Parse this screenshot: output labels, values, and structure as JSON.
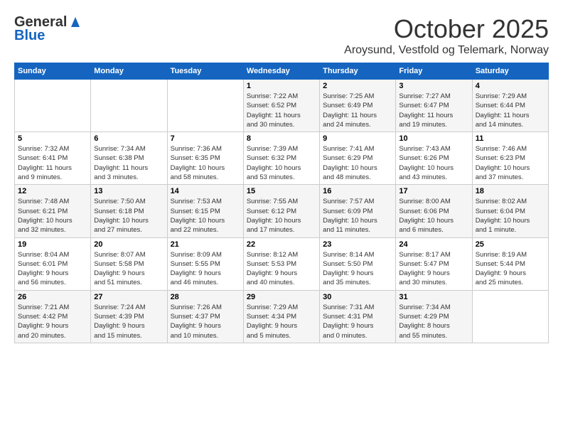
{
  "logo": {
    "general": "General",
    "blue": "Blue"
  },
  "title": {
    "month": "October 2025",
    "location": "Aroysund, Vestfold og Telemark, Norway"
  },
  "headers": [
    "Sunday",
    "Monday",
    "Tuesday",
    "Wednesday",
    "Thursday",
    "Friday",
    "Saturday"
  ],
  "weeks": [
    [
      {
        "day": "",
        "info": ""
      },
      {
        "day": "",
        "info": ""
      },
      {
        "day": "",
        "info": ""
      },
      {
        "day": "1",
        "info": "Sunrise: 7:22 AM\nSunset: 6:52 PM\nDaylight: 11 hours\nand 30 minutes."
      },
      {
        "day": "2",
        "info": "Sunrise: 7:25 AM\nSunset: 6:49 PM\nDaylight: 11 hours\nand 24 minutes."
      },
      {
        "day": "3",
        "info": "Sunrise: 7:27 AM\nSunset: 6:47 PM\nDaylight: 11 hours\nand 19 minutes."
      },
      {
        "day": "4",
        "info": "Sunrise: 7:29 AM\nSunset: 6:44 PM\nDaylight: 11 hours\nand 14 minutes."
      }
    ],
    [
      {
        "day": "5",
        "info": "Sunrise: 7:32 AM\nSunset: 6:41 PM\nDaylight: 11 hours\nand 9 minutes."
      },
      {
        "day": "6",
        "info": "Sunrise: 7:34 AM\nSunset: 6:38 PM\nDaylight: 11 hours\nand 3 minutes."
      },
      {
        "day": "7",
        "info": "Sunrise: 7:36 AM\nSunset: 6:35 PM\nDaylight: 10 hours\nand 58 minutes."
      },
      {
        "day": "8",
        "info": "Sunrise: 7:39 AM\nSunset: 6:32 PM\nDaylight: 10 hours\nand 53 minutes."
      },
      {
        "day": "9",
        "info": "Sunrise: 7:41 AM\nSunset: 6:29 PM\nDaylight: 10 hours\nand 48 minutes."
      },
      {
        "day": "10",
        "info": "Sunrise: 7:43 AM\nSunset: 6:26 PM\nDaylight: 10 hours\nand 43 minutes."
      },
      {
        "day": "11",
        "info": "Sunrise: 7:46 AM\nSunset: 6:23 PM\nDaylight: 10 hours\nand 37 minutes."
      }
    ],
    [
      {
        "day": "12",
        "info": "Sunrise: 7:48 AM\nSunset: 6:21 PM\nDaylight: 10 hours\nand 32 minutes."
      },
      {
        "day": "13",
        "info": "Sunrise: 7:50 AM\nSunset: 6:18 PM\nDaylight: 10 hours\nand 27 minutes."
      },
      {
        "day": "14",
        "info": "Sunrise: 7:53 AM\nSunset: 6:15 PM\nDaylight: 10 hours\nand 22 minutes."
      },
      {
        "day": "15",
        "info": "Sunrise: 7:55 AM\nSunset: 6:12 PM\nDaylight: 10 hours\nand 17 minutes."
      },
      {
        "day": "16",
        "info": "Sunrise: 7:57 AM\nSunset: 6:09 PM\nDaylight: 10 hours\nand 11 minutes."
      },
      {
        "day": "17",
        "info": "Sunrise: 8:00 AM\nSunset: 6:06 PM\nDaylight: 10 hours\nand 6 minutes."
      },
      {
        "day": "18",
        "info": "Sunrise: 8:02 AM\nSunset: 6:04 PM\nDaylight: 10 hours\nand 1 minute."
      }
    ],
    [
      {
        "day": "19",
        "info": "Sunrise: 8:04 AM\nSunset: 6:01 PM\nDaylight: 9 hours\nand 56 minutes."
      },
      {
        "day": "20",
        "info": "Sunrise: 8:07 AM\nSunset: 5:58 PM\nDaylight: 9 hours\nand 51 minutes."
      },
      {
        "day": "21",
        "info": "Sunrise: 8:09 AM\nSunset: 5:55 PM\nDaylight: 9 hours\nand 46 minutes."
      },
      {
        "day": "22",
        "info": "Sunrise: 8:12 AM\nSunset: 5:53 PM\nDaylight: 9 hours\nand 40 minutes."
      },
      {
        "day": "23",
        "info": "Sunrise: 8:14 AM\nSunset: 5:50 PM\nDaylight: 9 hours\nand 35 minutes."
      },
      {
        "day": "24",
        "info": "Sunrise: 8:17 AM\nSunset: 5:47 PM\nDaylight: 9 hours\nand 30 minutes."
      },
      {
        "day": "25",
        "info": "Sunrise: 8:19 AM\nSunset: 5:44 PM\nDaylight: 9 hours\nand 25 minutes."
      }
    ],
    [
      {
        "day": "26",
        "info": "Sunrise: 7:21 AM\nSunset: 4:42 PM\nDaylight: 9 hours\nand 20 minutes."
      },
      {
        "day": "27",
        "info": "Sunrise: 7:24 AM\nSunset: 4:39 PM\nDaylight: 9 hours\nand 15 minutes."
      },
      {
        "day": "28",
        "info": "Sunrise: 7:26 AM\nSunset: 4:37 PM\nDaylight: 9 hours\nand 10 minutes."
      },
      {
        "day": "29",
        "info": "Sunrise: 7:29 AM\nSunset: 4:34 PM\nDaylight: 9 hours\nand 5 minutes."
      },
      {
        "day": "30",
        "info": "Sunrise: 7:31 AM\nSunset: 4:31 PM\nDaylight: 9 hours\nand 0 minutes."
      },
      {
        "day": "31",
        "info": "Sunrise: 7:34 AM\nSunset: 4:29 PM\nDaylight: 8 hours\nand 55 minutes."
      },
      {
        "day": "",
        "info": ""
      }
    ]
  ]
}
